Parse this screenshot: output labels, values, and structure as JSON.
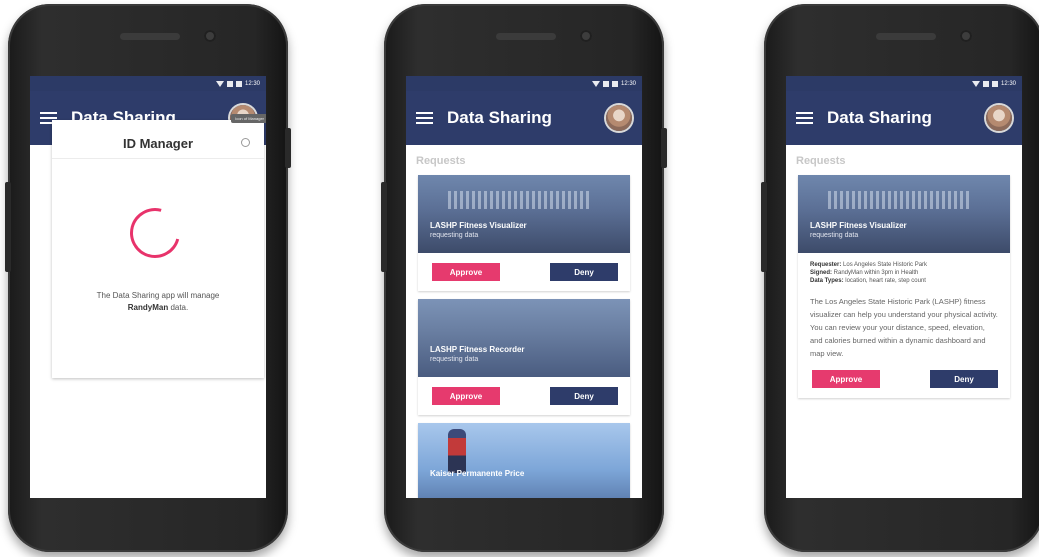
{
  "app": {
    "title": "Data Sharing",
    "status_time": "12:30"
  },
  "screen1": {
    "tooltip": "Icon of Manager",
    "card_title": "ID Manager",
    "message_before": "The Data Sharing app will manage",
    "message_user": "RandyMan",
    "message_after": "data."
  },
  "requests": {
    "header": "Requests",
    "approve_label": "Approve",
    "deny_label": "Deny",
    "items": [
      {
        "title": "LASHP Fitness Visualizer",
        "subtitle": "requesting data"
      },
      {
        "title": "LASHP Fitness Recorder",
        "subtitle": "requesting data"
      },
      {
        "title": "Kaiser Permanente Price",
        "subtitle": ""
      }
    ]
  },
  "details": {
    "requester_label": "Requester:",
    "requester_value": "Los Angeles State Historic Park",
    "signed_label": "Signed:",
    "signed_value": "RandyMan within 3pm in Health",
    "types_label": "Data Types:",
    "types_value": "location, heart rate, step count",
    "description": "The Los Angeles State Historic Park (LASHP) fitness visualizer can help you understand your physical activity. You can review your your distance, speed, elevation, and calories burned within a dynamic dashboard and map view."
  },
  "colors": {
    "app_bar": "#2e3c6a",
    "approve": "#e63a6e",
    "deny": "#2e3c6a",
    "spinner": "#e8336b"
  }
}
